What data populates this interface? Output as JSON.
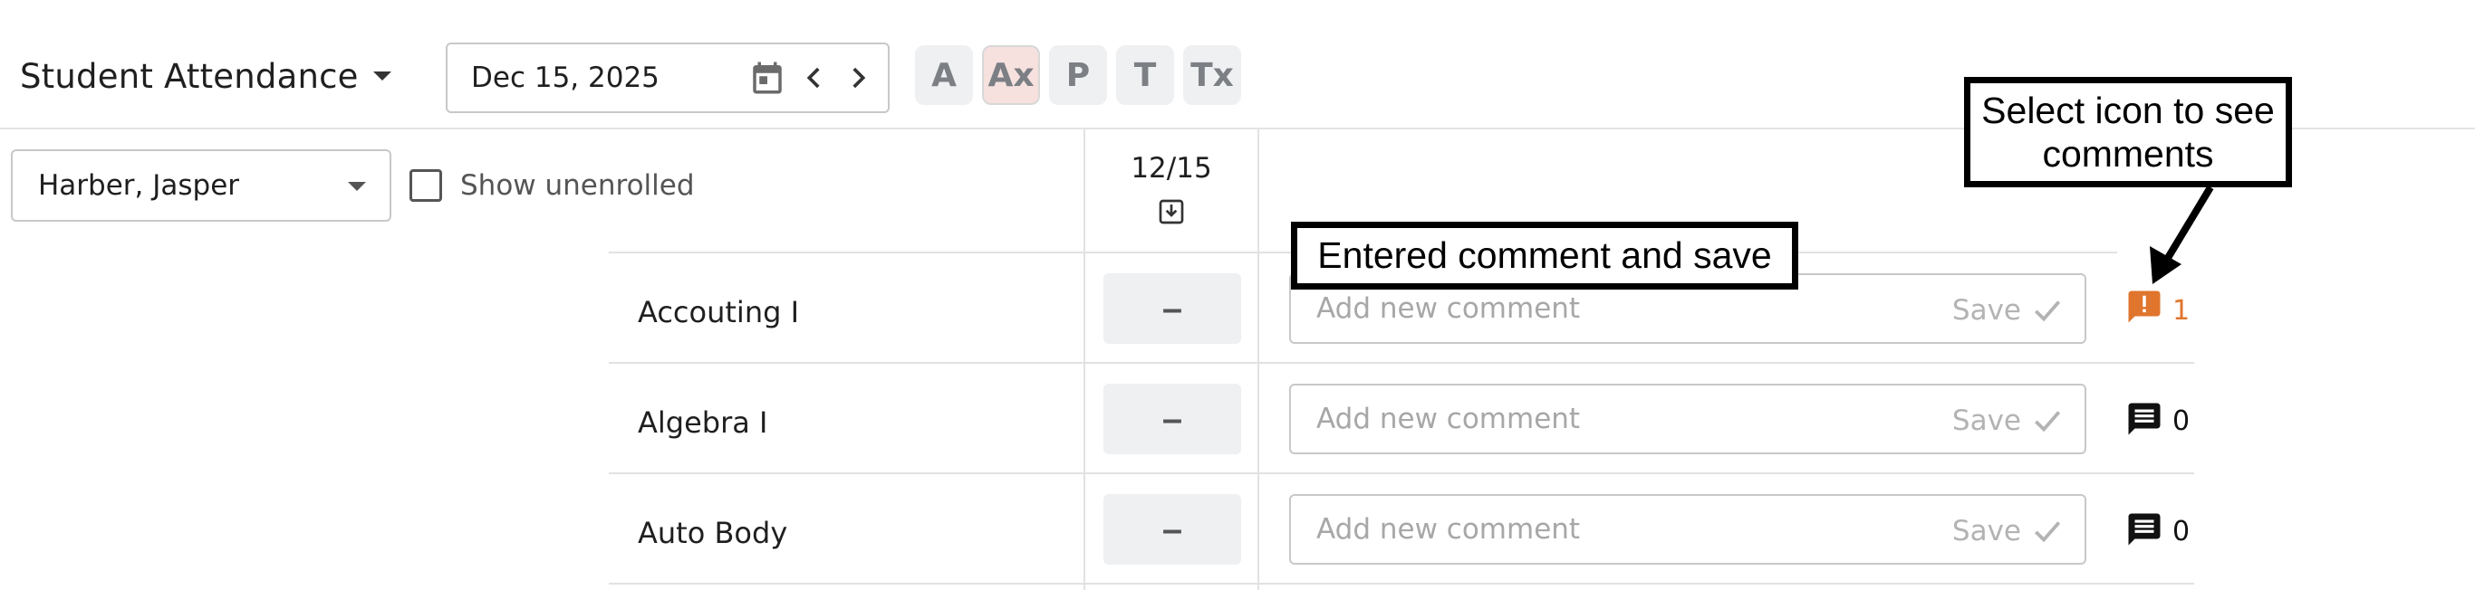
{
  "header": {
    "title": "Student Attendance",
    "date_value": "Dec 15, 2025",
    "codes": [
      "A",
      "Ax",
      "P",
      "T",
      "Tx"
    ],
    "active_code": "Ax"
  },
  "filters": {
    "student": "Harber, Jasper",
    "show_unenrolled_label": "Show unenrolled",
    "show_unenrolled_checked": false
  },
  "grid": {
    "date_column": "12/15",
    "comment_placeholder": "Add new comment",
    "save_label": "Save",
    "rows": [
      {
        "course": "Accouting I",
        "mark": "–",
        "comment_count": "1",
        "has_alert": true
      },
      {
        "course": "Algebra I",
        "mark": "–",
        "comment_count": "0",
        "has_alert": false
      },
      {
        "course": "Auto Body",
        "mark": "–",
        "comment_count": "0",
        "has_alert": false
      }
    ]
  },
  "annotations": {
    "comment_callout": "Entered comment and save",
    "icon_callout_line1": "Select icon to see",
    "icon_callout_line2": "comments"
  },
  "colors": {
    "alert": "#e0752d",
    "active_code_bg": "#f6e1df",
    "button_bg": "#eef0f2"
  },
  "icons": {
    "calendar": "calendar-icon",
    "prev": "chevron-left-icon",
    "next": "chevron-right-icon",
    "download": "download-icon",
    "comment": "comment-icon",
    "comment_alert": "comment-alert-icon",
    "check": "check-icon"
  }
}
